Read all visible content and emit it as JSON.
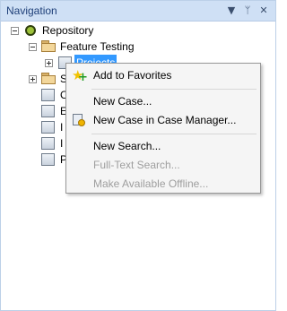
{
  "panel": {
    "title": "Navigation"
  },
  "titlebar_buttons": [
    {
      "name": "dropdown-icon",
      "glyph": "▼"
    },
    {
      "name": "pin-icon",
      "glyph": "ᛘ"
    },
    {
      "name": "close-icon",
      "glyph": "✕"
    }
  ],
  "tree": {
    "repository": "Repository",
    "feature_testing": "Feature Testing",
    "projects": "Projects",
    "partial_labels": [
      "S",
      "C",
      "E",
      "I",
      "I",
      "P"
    ]
  },
  "context_menu": {
    "items": [
      {
        "label": "Add to Favorites",
        "enabled": true,
        "icon": "add-favorite-icon"
      },
      {
        "label": "New Case...",
        "enabled": true
      },
      {
        "label": "New Case in Case Manager...",
        "enabled": true,
        "icon": "case-manager-icon"
      },
      {
        "label": "New Search...",
        "enabled": true
      },
      {
        "label": "Full-Text Search...",
        "enabled": false
      },
      {
        "label": "Make Available Offline...",
        "enabled": false
      }
    ]
  }
}
